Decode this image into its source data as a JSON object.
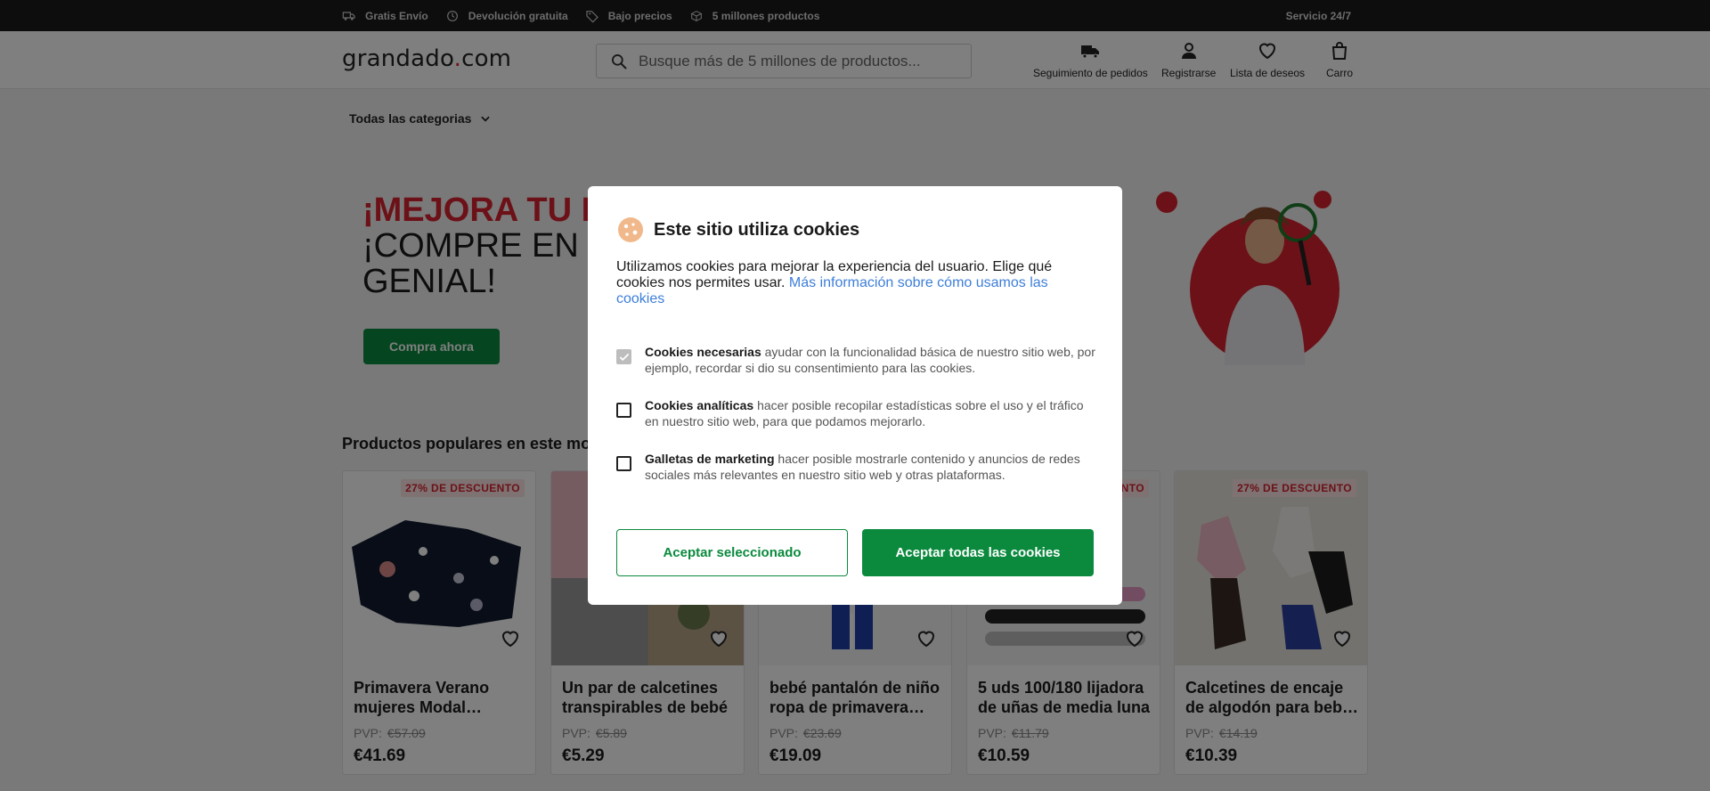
{
  "topbar": {
    "items": [
      {
        "label": "Gratis Envío",
        "icon": "truck-icon"
      },
      {
        "label": "Devolución gratuita",
        "icon": "return-clock-icon"
      },
      {
        "label": "Bajo precios",
        "icon": "price-tag-icon"
      },
      {
        "label": "5 millones productos",
        "icon": "boxes-icon"
      }
    ],
    "service": "Servicio 24/7"
  },
  "header": {
    "logo_main": "grandado",
    "logo_dot": ".",
    "logo_tld": "com",
    "search_placeholder": "Busque más de 5 millones de productos...",
    "nav": {
      "tracking": "Seguimiento de pedidos",
      "register": "Registrarse",
      "wishlist": "Lista de deseos",
      "cart": "Carro"
    }
  },
  "categories": {
    "label": "Todas las categorias"
  },
  "banner": {
    "line1": "¡MEJORA TU EN",
    "line2": "¡COMPRE EN FO",
    "line3": "GENIAL!",
    "cta": "Compra ahora"
  },
  "products": {
    "section_title": "Productos populares en este mom",
    "pvp_label": "PVP:",
    "items": [
      {
        "badge": "27% DE DESCUENTO",
        "title": "Primavera Verano mujeres Modal sleepwear",
        "old_price": "€57.09",
        "price": "€41.69"
      },
      {
        "badge": "",
        "title": "Un par de calcetines transpirables de bebé",
        "old_price": "€5.89",
        "price": "€5.29"
      },
      {
        "badge": "",
        "title": "bebé pantalón de niño ropa de primavera otoño",
        "old_price": "€23.69",
        "price": "€19.09"
      },
      {
        "badge": "27% DE DESCUENTO",
        "title": "5 uds 100/180 lijadora de uñas de media luna",
        "old_price": "€11.79",
        "price": "€10.59"
      },
      {
        "badge": "27% DE DESCUENTO",
        "title": "Calcetines de encaje de algodón para bebé y niña",
        "old_price": "€14.19",
        "price": "€10.39"
      }
    ]
  },
  "cookie_modal": {
    "title": "Este sitio utiliza cookies",
    "intro": "Utilizamos cookies para mejorar la experiencia del usuario. Elige qué cookies nos permites usar.",
    "intro_link": "Más información sobre cómo usamos las cookies",
    "options": [
      {
        "name": "Cookies necesarias",
        "desc": "ayudar con la funcionalidad básica de nuestro sitio web, por ejemplo, recordar si dio su consentimiento para las cookies.",
        "checked": true
      },
      {
        "name": "Cookies analíticas",
        "desc": "hacer posible recopilar estadísticas sobre el uso y el tráfico en nuestro sitio web, para que podamos mejorarlo.",
        "checked": false
      },
      {
        "name": "Galletas de marketing",
        "desc": "hacer posible mostrarle contenido y anuncios de redes sociales más relevantes en nuestro sitio web y otras plataformas.",
        "checked": false
      }
    ],
    "btn_selected": "Aceptar seleccionado",
    "btn_all": "Aceptar todas las cookies"
  },
  "colors": {
    "brand_red": "#e3222e",
    "brand_green": "#0b8a3e",
    "link_blue": "#3d7ed8"
  }
}
